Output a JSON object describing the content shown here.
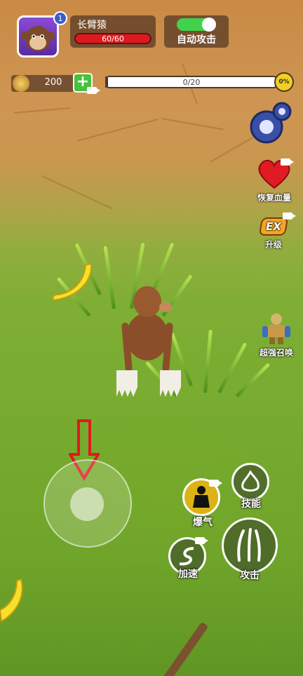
{
  "player": {
    "level": "1",
    "name": "长臂猿",
    "hp_text": "60/60",
    "hp_fraction": 1.0
  },
  "auto_attack": {
    "label": "自动攻击",
    "enabled": true
  },
  "currency": {
    "coins": "200"
  },
  "progress": {
    "text": "0/20",
    "percent_label": "0%",
    "fraction": 0
  },
  "side_buttons": {
    "restore_hp": "恢复血量",
    "upgrade": "升级",
    "summon": "超强召唤",
    "exp_badge": "EX"
  },
  "actions": {
    "burst": "爆气",
    "skill": "技能",
    "speed": "加速",
    "attack": "攻击"
  },
  "colors": {
    "hp": "#e0191e",
    "toggle_on": "#41d24c",
    "accent_yellow": "#f2d021",
    "plus_green": "#45c23e"
  },
  "icons": {
    "avatar": "monkey-portrait",
    "coin": "banana-coin",
    "settings": "gear-icon",
    "restore_hp": "heart-icon",
    "upgrade": "exp-up-icon",
    "summon": "golem-icon",
    "joystick_hint": "down-arrow",
    "burst": "silhouette-icon",
    "skill": "flame-icon",
    "speed": "dash-icon",
    "attack": "claw-icon"
  }
}
